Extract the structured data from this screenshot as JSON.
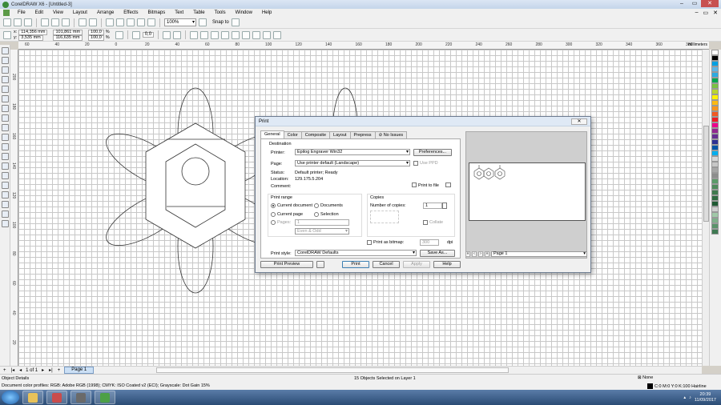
{
  "window": {
    "title": "CorelDRAW X6 - [Untitled-3]",
    "min": "–",
    "max": "▭",
    "close": "✕"
  },
  "menu": [
    "File",
    "Edit",
    "View",
    "Layout",
    "Arrange",
    "Effects",
    "Bitmaps",
    "Text",
    "Table",
    "Tools",
    "Window",
    "Help"
  ],
  "menu_right": {
    "min": "–",
    "restore": "▭",
    "close": "✕"
  },
  "toolbar": {
    "zoom": "100%",
    "snap_to": "Snap to",
    "rotation": "0,0"
  },
  "property_bar": {
    "x": "114,356 mm",
    "y": "3,535 mm",
    "w": "101,861 mm",
    "h": "116,635 mm",
    "scale_x": "100,0",
    "scale_y": "100,0",
    "pct": "%"
  },
  "ruler": {
    "units": "millimeters",
    "h_labels": [
      "60",
      "40",
      "20",
      "0",
      "20",
      "40",
      "60",
      "80",
      "100",
      "120",
      "140",
      "160",
      "180",
      "200",
      "220",
      "240",
      "260",
      "280",
      "300",
      "320",
      "340",
      "360",
      "380"
    ],
    "v_labels": [
      "200",
      "180",
      "160",
      "140",
      "120",
      "100",
      "80",
      "60",
      "40",
      "20"
    ]
  },
  "page_nav": {
    "first": "|◂",
    "prev": "◂",
    "counter": "1 of 1",
    "next": "▸",
    "last": "▸|",
    "add": "+",
    "tab": "Page 1"
  },
  "status": {
    "object_details": "Object Details",
    "selection": "15 Objects Selected on Layer 1",
    "profiles": "Document color profiles: RGB: Adobe RGB (1998); CMYK: ISO Coated v2 (ECI); Grayscale: Dot Gain 15%",
    "fill": "None",
    "outline": "C:0 M:0 Y:0 K:100  Hairline"
  },
  "taskbar": {
    "time": "20:39",
    "date": "11/09/2017"
  },
  "dialog": {
    "title": "Print",
    "close": "✕",
    "tabs": [
      "General",
      "Color",
      "Composite",
      "Layout",
      "Prepress",
      "No Issues"
    ],
    "destination_label": "Destination",
    "printer_label": "Printer:",
    "printer_value": "Epilog Engraver Win32",
    "preferences_btn": "Preferences...",
    "page_label": "Page:",
    "page_value": "Use printer default (Landscape)",
    "use_ppd": "Use PPD",
    "status_label": "Status:",
    "status_value": "Default printer; Ready",
    "location_label": "Location:",
    "location_value": "129.175.5.204",
    "comment_label": "Comment:",
    "print_to_file": "Print to file",
    "print_range_label": "Print range",
    "current_document": "Current document",
    "documents": "Documents",
    "current_page": "Current page",
    "selection": "Selection",
    "pages_label": "Pages:",
    "pages_value": "1",
    "even_odd": "Even & Odd",
    "copies_label": "Copies",
    "num_copies_label": "Number of copies:",
    "num_copies_value": "1",
    "collate": "Collate",
    "print_as_bitmap": "Print as bitmap:",
    "dpi_value": "300",
    "dpi_unit": "dpi",
    "print_style_label": "Print style:",
    "print_style_value": "CorelDRAW Defaults",
    "save_as_btn": "Save As...",
    "print_preview_btn": "Print Preview",
    "print_btn": "Print",
    "cancel_btn": "Cancel",
    "apply_btn": "Apply",
    "help_btn": "Help",
    "preview_page": "Page 1"
  },
  "palette_colors": [
    "#ffffff",
    "#000000",
    "#00a0e3",
    "#5eb5e6",
    "#2cabe2",
    "#00a54f",
    "#7ac143",
    "#b9d531",
    "#fff200",
    "#fcb913",
    "#f7941d",
    "#f15a24",
    "#ed1c24",
    "#ec008c",
    "#92278f",
    "#662d91",
    "#2e3192",
    "#0054a6",
    "#00aeef",
    "#d7d7d7",
    "#c7c7c7",
    "#a7a7a7",
    "#8d8d8d",
    "#5b9a68",
    "#4e8a5b",
    "#3f7a4e",
    "#2e6a40",
    "#1f5a33",
    "#cfcfcf",
    "#a1c8a8",
    "#7fb08a",
    "#5b936b",
    "#3e7a52"
  ]
}
